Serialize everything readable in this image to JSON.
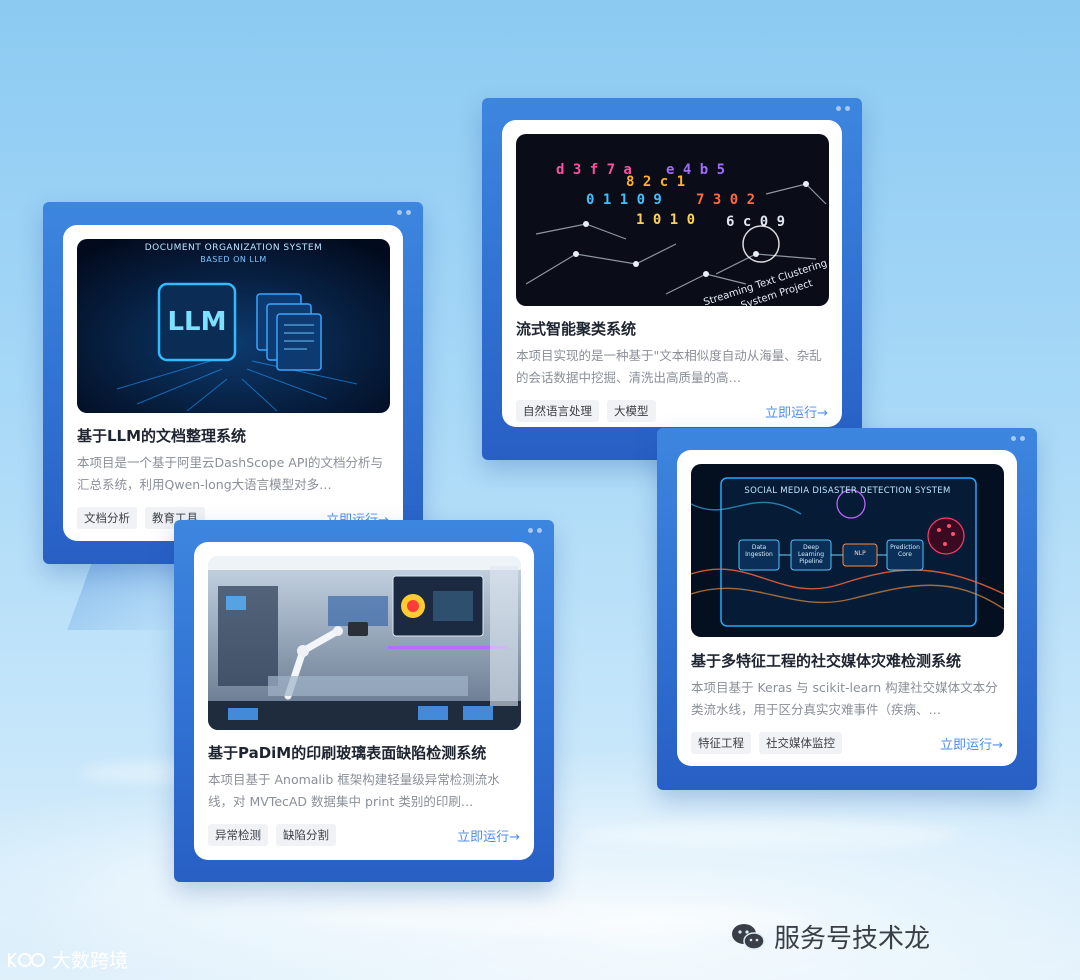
{
  "cards": [
    {
      "title": "基于LLM的文档整理系统",
      "desc": "本项目是一个基于阿里云DashScope API的文档分析与汇总系统，利用Qwen-long大语言模型对多…",
      "tags": [
        "文档分析",
        "教育工具"
      ],
      "run": "立即运行→",
      "image": {
        "line1": "DOCUMENT ORGANIZATION SYSTEM",
        "line2": "BASED ON LLM",
        "badge": "LLM"
      }
    },
    {
      "title": "流式智能聚类系统",
      "desc": "本项目实现的是一种基于\"文本相似度自动从海量、杂乱的会话数据中挖掘、清洗出高质量的高…",
      "tags": [
        "自然语言处理",
        "大模型"
      ],
      "run": "立即运行→",
      "image": {
        "line1": "Streaming Text Clustering",
        "line2": "System Project"
      }
    },
    {
      "title": "基于PaDiM的印刷玻璃表面缺陷检测系统",
      "desc": "本项目基于 Anomalib 框架构建轻量级异常检测流水线，对 MVTecAD 数据集中 print 类别的印刷…",
      "tags": [
        "异常检测",
        "缺陷分割"
      ],
      "run": "立即运行→"
    },
    {
      "title": "基于多特征工程的社交媒体灾难检测系统",
      "desc": "本项目基于 Keras 与 scikit-learn 构建社交媒体文本分类流水线，用于区分真实灾难事件（疾病、…",
      "tags": [
        "特征工程",
        "社交媒体监控"
      ],
      "run": "立即运行→",
      "image": {
        "line1": "SOCIAL MEDIA DISASTER DETECTION SYSTEM",
        "steps": [
          "Data Ingestion",
          "Deep Learning Pipeline",
          "NLP",
          "Prediction Core"
        ]
      }
    }
  ],
  "footer": {
    "brand": "大数跨境",
    "watermark": "服务号技术龙"
  }
}
